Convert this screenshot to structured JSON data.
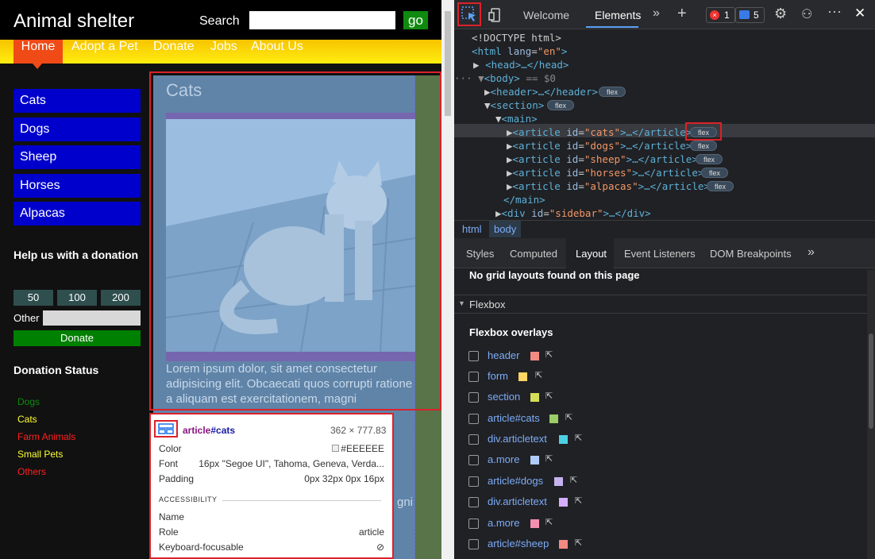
{
  "site": {
    "title": "Animal shelter",
    "search_label": "Search",
    "go_label": "go",
    "nav": [
      "Home",
      "Adopt a Pet",
      "Donate",
      "Jobs",
      "About Us"
    ],
    "sidebar": [
      "Cats",
      "Dogs",
      "Sheep",
      "Horses",
      "Alpacas"
    ],
    "help_title": "Help us with a donation",
    "amounts": [
      "50",
      "100",
      "200"
    ],
    "other_label": "Other",
    "donate_label": "Donate",
    "status_title": "Donation Status",
    "statuses": [
      {
        "label": "Dogs",
        "color": "#0f8a0f"
      },
      {
        "label": "Cats",
        "color": "#ffff33"
      },
      {
        "label": "Farm Animals",
        "color": "#ff2020"
      },
      {
        "label": "Small Pets",
        "color": "#ffff33"
      },
      {
        "label": "Others",
        "color": "#ff2020"
      }
    ],
    "article_title": "Cats",
    "lorem": "Lorem ipsum dolor, sit amet consectetur adipisicing elit. Obcaecati quos corrupti ratione a aliquam est exercitationem, magni",
    "lorem_tail": "gni"
  },
  "tooltip": {
    "name_tag": "article",
    "name_id": "#cats",
    "size": "362 × 777.83",
    "color_label": "Color",
    "color_value": "#EEEEEE",
    "font_label": "Font",
    "font_value": "16px \"Segoe UI\", Tahoma, Geneva, Verda...",
    "padding_label": "Padding",
    "padding_value": "0px 32px 0px 16px",
    "accessibility": "ACCESSIBILITY",
    "name_label": "Name",
    "role_label": "Role",
    "role_value": "article",
    "focus_label": "Keyboard-focusable"
  },
  "devtools": {
    "tabs": [
      "Welcome",
      "Elements"
    ],
    "errors": "1",
    "messages": "5",
    "dom": {
      "doctype": "<!DOCTYPE html>",
      "html": "html",
      "html_lang_attr": "lang",
      "html_lang_val": "\"en\"",
      "head": "<head>…</head>",
      "body": "<body>",
      "body_suffix": "== $0",
      "header": "<header>…</header>",
      "section": "<section>",
      "main": "<main>",
      "articles": [
        {
          "id": "\"cats\""
        },
        {
          "id": "\"dogs\""
        },
        {
          "id": "\"sheep\""
        },
        {
          "id": "\"horses\""
        },
        {
          "id": "\"alpacas\""
        }
      ],
      "main_close": "</main>",
      "sidebar_div": "\"sidebar\"",
      "flex": "flex"
    },
    "crumbs": [
      "html",
      "body"
    ],
    "subtabs": [
      "Styles",
      "Computed",
      "Layout",
      "Event Listeners",
      "DOM Breakpoints"
    ],
    "no_grid": "No grid layouts found on this page",
    "flexbox_section": "Flexbox",
    "overlays_title": "Flexbox overlays",
    "overlays": [
      {
        "label": "header",
        "color": "#f28b82"
      },
      {
        "label": "form",
        "color": "#fdd663"
      },
      {
        "label": "section",
        "color": "#d4e157"
      },
      {
        "label": "article#cats",
        "color": "#9ccc65"
      },
      {
        "label": "div.articletext",
        "color": "#4dd0e1"
      },
      {
        "label": "a.more",
        "color": "#aecbfa"
      },
      {
        "label": "article#dogs",
        "color": "#c5b3f0"
      },
      {
        "label": "div.articletext",
        "color": "#d7aefb"
      },
      {
        "label": "a.more",
        "color": "#f48fb1"
      },
      {
        "label": "article#sheep",
        "color": "#f28b82"
      }
    ]
  }
}
